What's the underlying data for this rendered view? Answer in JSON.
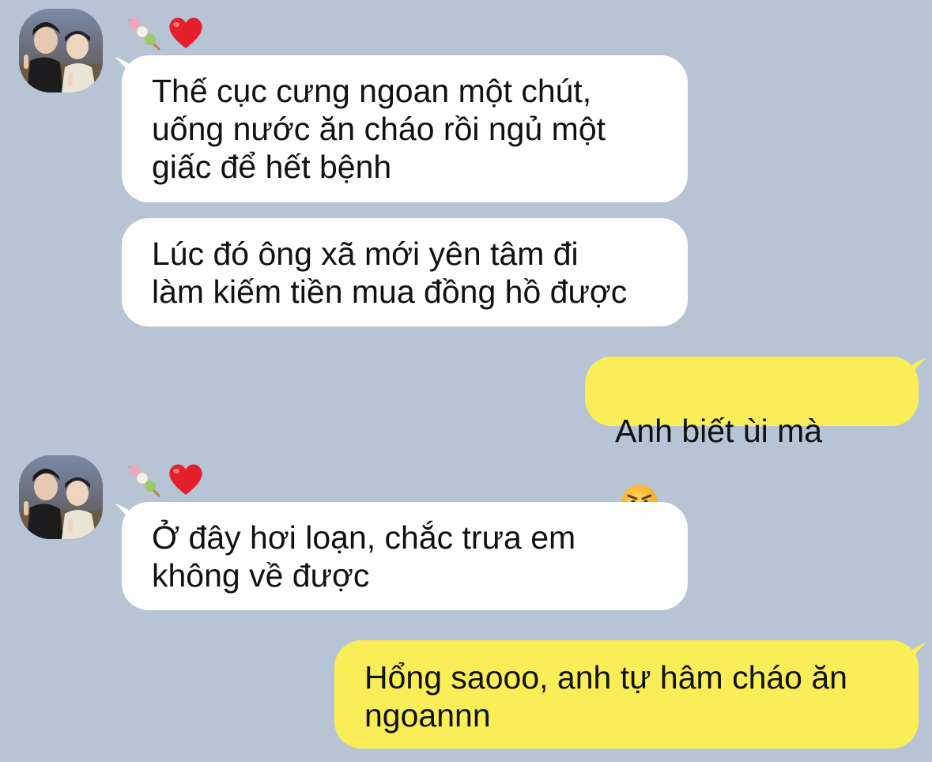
{
  "colors": {
    "background": "#b6c4d6",
    "incoming_bubble": "#ffffff",
    "outgoing_bubble": "#f9ed58",
    "text": "#111111",
    "heart": "#e6202a"
  },
  "messages": [
    {
      "sender": "contact",
      "name_icons": [
        "dango-icon",
        "red-heart-icon"
      ],
      "bubbles": [
        {
          "text": "Thế cục cưng ngoan một chút,\nuống nước ăn cháo rồi ngủ một\ngiấc để hết bệnh"
        },
        {
          "text": "Lúc đó ông xã mới yên tâm đi\nlàm kiếm tiền mua đồng hồ được"
        }
      ]
    },
    {
      "sender": "me",
      "bubbles": [
        {
          "text": "Anh biết ùi mà",
          "emoji": "angry-face-icon"
        }
      ]
    },
    {
      "sender": "contact",
      "name_icons": [
        "dango-icon",
        "red-heart-icon"
      ],
      "bubbles": [
        {
          "text": "Ở đây hơi loạn, chắc trưa em\nkhông về được"
        }
      ]
    },
    {
      "sender": "me",
      "bubbles": [
        {
          "text": "Hổng saooo, anh tự hâm cháo ăn\nngoannn"
        }
      ]
    }
  ]
}
